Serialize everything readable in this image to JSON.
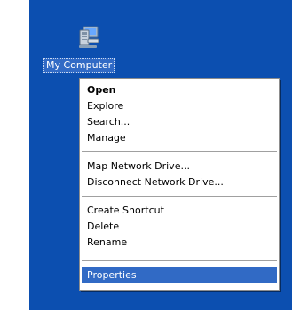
{
  "desktop": {
    "icon_label": "My Computer",
    "icon_name": "my-computer-icon",
    "background": "#0c4fb0"
  },
  "context_menu": {
    "items": [
      {
        "label": "Open",
        "bold": true
      },
      {
        "label": "Explore"
      },
      {
        "label": "Search..."
      },
      {
        "label": "Manage"
      },
      {
        "label": "Map Network Drive..."
      },
      {
        "label": "Disconnect Network Drive..."
      },
      {
        "label": "Create Shortcut"
      },
      {
        "label": "Delete"
      },
      {
        "label": "Rename"
      },
      {
        "label": "Properties",
        "selected": true
      }
    ],
    "highlight_color": "#316ac5"
  }
}
